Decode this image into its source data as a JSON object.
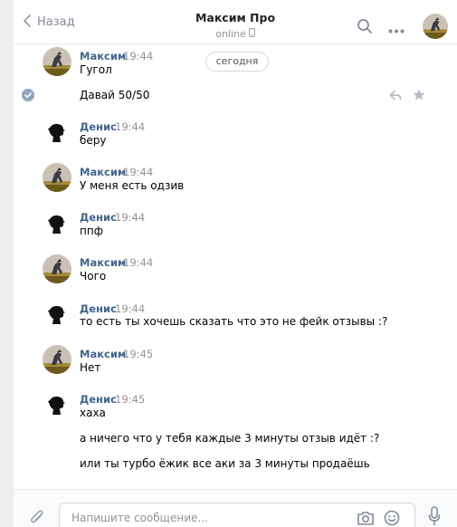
{
  "header": {
    "back_label": "Назад",
    "title": "Максим Про",
    "status": "online"
  },
  "date_divider": "сегодня",
  "messages": [
    {
      "author": "Максим",
      "time": "19:44",
      "lines": [
        "Гугол",
        "Давай 50/50"
      ]
    },
    {
      "author": "Денис",
      "time": "19:44",
      "lines": [
        "беру"
      ]
    },
    {
      "author": "Максим",
      "time": "19:44",
      "lines": [
        "У меня есть одзив"
      ]
    },
    {
      "author": "Денис",
      "time": "19:44",
      "lines": [
        "ппф"
      ]
    },
    {
      "author": "Максим",
      "time": "19:44",
      "lines": [
        "Чого"
      ]
    },
    {
      "author": "Денис",
      "time": "19:44",
      "lines": [
        "то есть ты хочешь сказать что это не фейк отзывы :?"
      ]
    },
    {
      "author": "Максим",
      "time": "19:45",
      "lines": [
        "Нет"
      ]
    },
    {
      "author": "Денис",
      "time": "19:45",
      "lines": [
        "хаха",
        "а ничего что у тебя каждые 3 минуты отзыв идёт :?",
        "или ты турбо ёжик все аки за 3 минуты продаёшь"
      ]
    }
  ],
  "composer": {
    "placeholder": "Напишите сообщение..."
  },
  "icons": {
    "back": "chevron-left-icon",
    "search": "search-icon",
    "more": "more-dots-icon",
    "phone": "phone-icon",
    "read": "check-icon",
    "reply": "reply-icon",
    "favorite": "star-icon",
    "attach": "paperclip-icon",
    "camera": "camera-icon",
    "emoji": "smile-icon",
    "voice": "microphone-icon"
  },
  "colors": {
    "name": "#42648b",
    "meta": "#939393",
    "read_mark": "#8ea5bf"
  }
}
